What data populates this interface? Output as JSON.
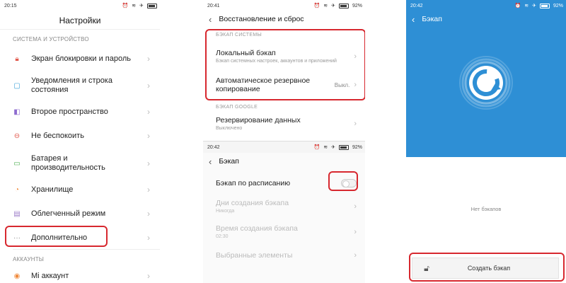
{
  "screen1": {
    "time": "20:15",
    "battery": "",
    "title": "Настройки",
    "section_system": "СИСТЕМА И УСТРОЙСТВО",
    "items": [
      {
        "label": "Экран блокировки и пароль",
        "icon": "lock-icon",
        "color": "#e25b4f"
      },
      {
        "label": "Уведомления и строка состояния",
        "icon": "notification-icon",
        "color": "#3aa0d8"
      },
      {
        "label": "Второе пространство",
        "icon": "second-space-icon",
        "color": "#8e6ccf"
      },
      {
        "label": "Не беспокоить",
        "icon": "do-not-disturb-icon",
        "color": "#e25b4f"
      },
      {
        "label": "Батарея и производительность",
        "icon": "battery-icon",
        "color": "#4caf50"
      },
      {
        "label": "Хранилище",
        "icon": "storage-icon",
        "color": "#f08a3c"
      },
      {
        "label": "Облегченный режим",
        "icon": "lite-mode-icon",
        "color": "#9c7cc8"
      },
      {
        "label": "Дополнительно",
        "icon": "more-icon",
        "color": "#888888"
      }
    ],
    "section_accounts": "АККАУНТЫ",
    "mi_account": "Mi аккаунт"
  },
  "screen2": {
    "time": "20:41",
    "battery": "92%",
    "title": "Восстановление и сброс",
    "section_system_backup": "БЭКАП СИСТЕМЫ",
    "local_backup": {
      "title": "Локальный бэкап",
      "subtitle": "Бэкап системных настроек, аккаунтов и приложений"
    },
    "auto_backup": {
      "title": "Автоматическое резервное копирование",
      "value": "Выкл."
    },
    "section_google": "БЭКАП GOOGLE",
    "data_backup": {
      "title": "Резервирование данных",
      "subtitle": "Выключено"
    }
  },
  "subscreen": {
    "time": "20:42",
    "battery": "92%",
    "title": "Бэкап",
    "scheduled": "Бэкап по расписанию",
    "scheduled_on": false,
    "days": {
      "title": "Дни создания бэкапа",
      "subtitle": "Никогда"
    },
    "time_of_backup": {
      "title": "Время создания бэкапа",
      "subtitle": "02:30"
    },
    "selected": "Выбранные элементы"
  },
  "screen3": {
    "time": "20:42",
    "battery": "92%",
    "title": "Бэкап",
    "empty_text": "Нет бэкапов",
    "create_button": "Создать бэкап",
    "accent": "#2e8fd5"
  },
  "colors": {
    "highlight": "#d7282f"
  }
}
